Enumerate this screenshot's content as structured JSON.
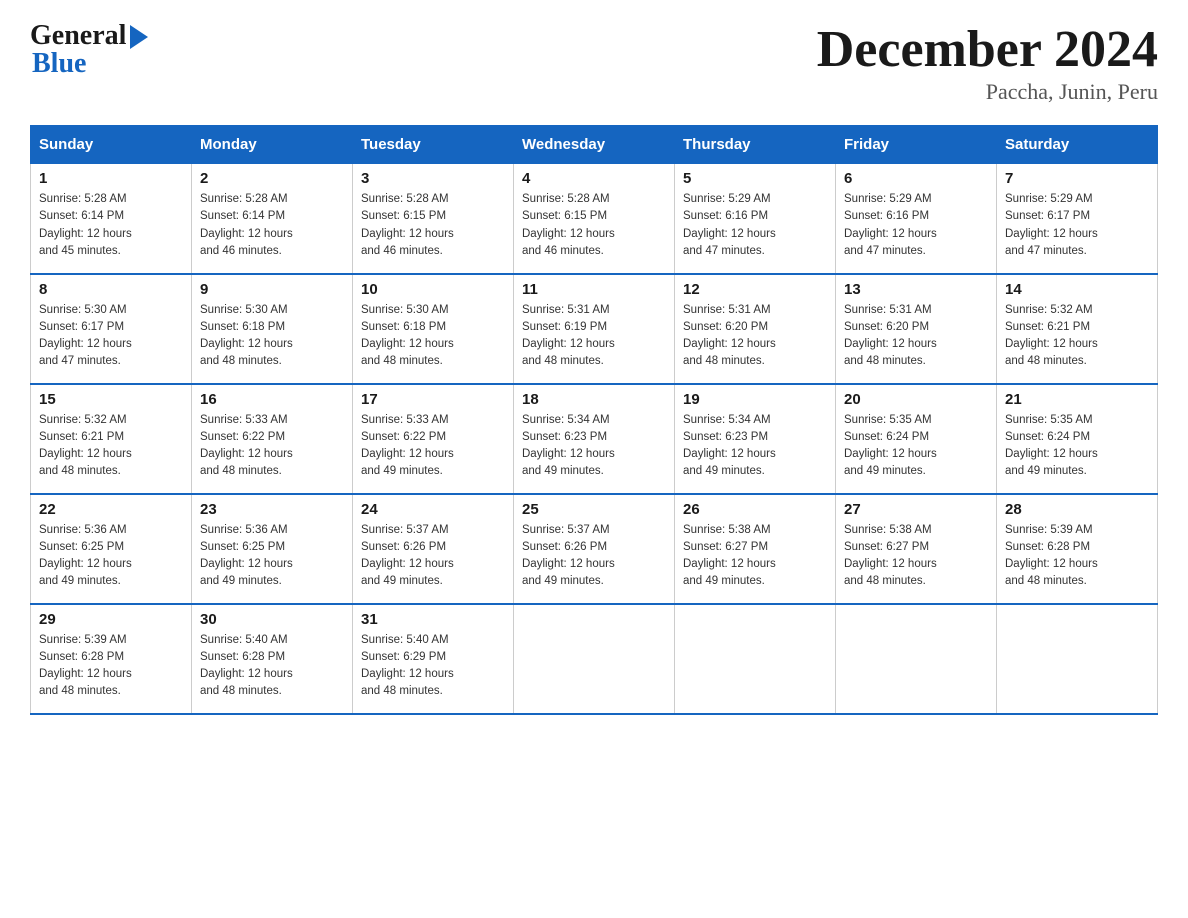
{
  "header": {
    "logo_general": "General",
    "logo_blue": "Blue",
    "month_title": "December 2024",
    "location": "Paccha, Junin, Peru"
  },
  "days_of_week": [
    "Sunday",
    "Monday",
    "Tuesday",
    "Wednesday",
    "Thursday",
    "Friday",
    "Saturday"
  ],
  "weeks": [
    [
      {
        "day": "1",
        "sunrise": "5:28 AM",
        "sunset": "6:14 PM",
        "daylight": "12 hours and 45 minutes."
      },
      {
        "day": "2",
        "sunrise": "5:28 AM",
        "sunset": "6:14 PM",
        "daylight": "12 hours and 46 minutes."
      },
      {
        "day": "3",
        "sunrise": "5:28 AM",
        "sunset": "6:15 PM",
        "daylight": "12 hours and 46 minutes."
      },
      {
        "day": "4",
        "sunrise": "5:28 AM",
        "sunset": "6:15 PM",
        "daylight": "12 hours and 46 minutes."
      },
      {
        "day": "5",
        "sunrise": "5:29 AM",
        "sunset": "6:16 PM",
        "daylight": "12 hours and 47 minutes."
      },
      {
        "day": "6",
        "sunrise": "5:29 AM",
        "sunset": "6:16 PM",
        "daylight": "12 hours and 47 minutes."
      },
      {
        "day": "7",
        "sunrise": "5:29 AM",
        "sunset": "6:17 PM",
        "daylight": "12 hours and 47 minutes."
      }
    ],
    [
      {
        "day": "8",
        "sunrise": "5:30 AM",
        "sunset": "6:17 PM",
        "daylight": "12 hours and 47 minutes."
      },
      {
        "day": "9",
        "sunrise": "5:30 AM",
        "sunset": "6:18 PM",
        "daylight": "12 hours and 48 minutes."
      },
      {
        "day": "10",
        "sunrise": "5:30 AM",
        "sunset": "6:18 PM",
        "daylight": "12 hours and 48 minutes."
      },
      {
        "day": "11",
        "sunrise": "5:31 AM",
        "sunset": "6:19 PM",
        "daylight": "12 hours and 48 minutes."
      },
      {
        "day": "12",
        "sunrise": "5:31 AM",
        "sunset": "6:20 PM",
        "daylight": "12 hours and 48 minutes."
      },
      {
        "day": "13",
        "sunrise": "5:31 AM",
        "sunset": "6:20 PM",
        "daylight": "12 hours and 48 minutes."
      },
      {
        "day": "14",
        "sunrise": "5:32 AM",
        "sunset": "6:21 PM",
        "daylight": "12 hours and 48 minutes."
      }
    ],
    [
      {
        "day": "15",
        "sunrise": "5:32 AM",
        "sunset": "6:21 PM",
        "daylight": "12 hours and 48 minutes."
      },
      {
        "day": "16",
        "sunrise": "5:33 AM",
        "sunset": "6:22 PM",
        "daylight": "12 hours and 48 minutes."
      },
      {
        "day": "17",
        "sunrise": "5:33 AM",
        "sunset": "6:22 PM",
        "daylight": "12 hours and 49 minutes."
      },
      {
        "day": "18",
        "sunrise": "5:34 AM",
        "sunset": "6:23 PM",
        "daylight": "12 hours and 49 minutes."
      },
      {
        "day": "19",
        "sunrise": "5:34 AM",
        "sunset": "6:23 PM",
        "daylight": "12 hours and 49 minutes."
      },
      {
        "day": "20",
        "sunrise": "5:35 AM",
        "sunset": "6:24 PM",
        "daylight": "12 hours and 49 minutes."
      },
      {
        "day": "21",
        "sunrise": "5:35 AM",
        "sunset": "6:24 PM",
        "daylight": "12 hours and 49 minutes."
      }
    ],
    [
      {
        "day": "22",
        "sunrise": "5:36 AM",
        "sunset": "6:25 PM",
        "daylight": "12 hours and 49 minutes."
      },
      {
        "day": "23",
        "sunrise": "5:36 AM",
        "sunset": "6:25 PM",
        "daylight": "12 hours and 49 minutes."
      },
      {
        "day": "24",
        "sunrise": "5:37 AM",
        "sunset": "6:26 PM",
        "daylight": "12 hours and 49 minutes."
      },
      {
        "day": "25",
        "sunrise": "5:37 AM",
        "sunset": "6:26 PM",
        "daylight": "12 hours and 49 minutes."
      },
      {
        "day": "26",
        "sunrise": "5:38 AM",
        "sunset": "6:27 PM",
        "daylight": "12 hours and 49 minutes."
      },
      {
        "day": "27",
        "sunrise": "5:38 AM",
        "sunset": "6:27 PM",
        "daylight": "12 hours and 48 minutes."
      },
      {
        "day": "28",
        "sunrise": "5:39 AM",
        "sunset": "6:28 PM",
        "daylight": "12 hours and 48 minutes."
      }
    ],
    [
      {
        "day": "29",
        "sunrise": "5:39 AM",
        "sunset": "6:28 PM",
        "daylight": "12 hours and 48 minutes."
      },
      {
        "day": "30",
        "sunrise": "5:40 AM",
        "sunset": "6:28 PM",
        "daylight": "12 hours and 48 minutes."
      },
      {
        "day": "31",
        "sunrise": "5:40 AM",
        "sunset": "6:29 PM",
        "daylight": "12 hours and 48 minutes."
      },
      null,
      null,
      null,
      null
    ]
  ],
  "labels": {
    "sunrise": "Sunrise:",
    "sunset": "Sunset:",
    "daylight": "Daylight:"
  }
}
